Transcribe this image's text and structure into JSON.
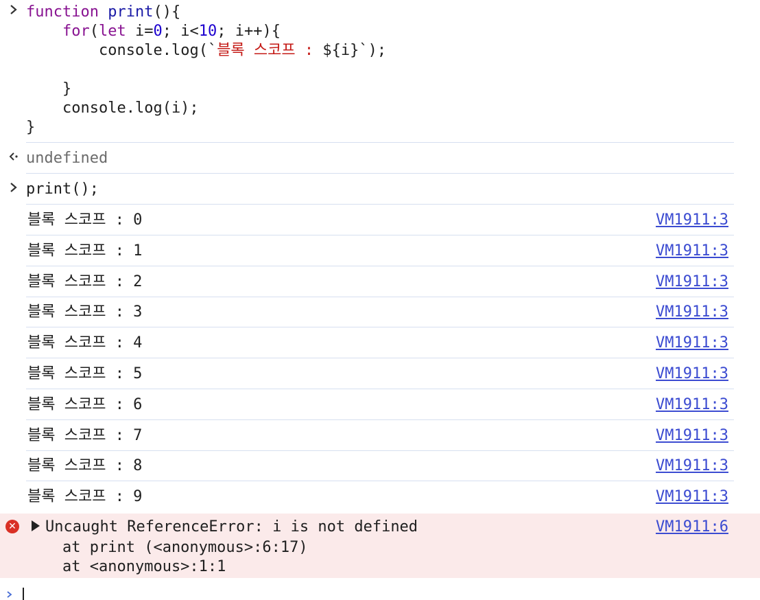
{
  "input1": {
    "prompt_icon": "chevron-right-icon",
    "lines": [
      {
        "kw": "function",
        "fn": "print",
        "rest": "(){"
      },
      {
        "kw": "for",
        "rest_a": "(",
        "kw2": "let",
        "var": " i=",
        "num": "0",
        "rest_b": "; i<",
        "num2": "10",
        "rest_c": "; i++){"
      },
      {
        "pre": "console.log(`",
        "str": "블록 스코프 : ",
        "post": "${i}`);"
      },
      {
        "text": ""
      },
      {
        "text": "}"
      },
      {
        "text": "console.log(i);"
      },
      {
        "text": "}"
      }
    ]
  },
  "result1": {
    "prompt_icon": "return-arrow-icon",
    "text": "undefined"
  },
  "input2": {
    "prompt_icon": "chevron-right-icon",
    "text": "print();"
  },
  "logs": [
    {
      "text": "블록 스코프 : 0",
      "source": "VM1911:3"
    },
    {
      "text": "블록 스코프 : 1",
      "source": "VM1911:3"
    },
    {
      "text": "블록 스코프 : 2",
      "source": "VM1911:3"
    },
    {
      "text": "블록 스코프 : 3",
      "source": "VM1911:3"
    },
    {
      "text": "블록 스코프 : 4",
      "source": "VM1911:3"
    },
    {
      "text": "블록 스코프 : 5",
      "source": "VM1911:3"
    },
    {
      "text": "블록 스코프 : 6",
      "source": "VM1911:3"
    },
    {
      "text": "블록 스코프 : 7",
      "source": "VM1911:3"
    },
    {
      "text": "블록 스코프 : 8",
      "source": "VM1911:3"
    },
    {
      "text": "블록 스코프 : 9",
      "source": "VM1911:3"
    }
  ],
  "error": {
    "icon": "error-x-icon",
    "icon_glyph": "✕",
    "message": "Uncaught ReferenceError: i is not defined",
    "source": "VM1911:6",
    "stack": [
      "at print (<anonymous>:6:17)",
      "at <anonymous>:1:1"
    ],
    "colors": {
      "background": "#fbeaea",
      "icon": "#d93025"
    }
  },
  "input3": {
    "prompt_icon": "chevron-right-icon"
  },
  "colors": {
    "keyword": "#8a2be2",
    "string": "#c41a16",
    "number": "#1c00cf",
    "link": "#3b4bd1",
    "separator": "#d6dff0"
  }
}
